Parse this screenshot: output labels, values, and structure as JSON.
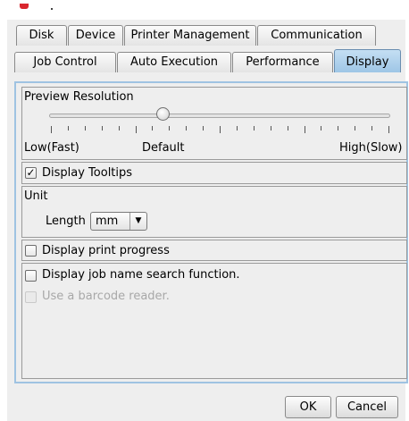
{
  "tabs_row1": [
    {
      "label": "Disk"
    },
    {
      "label": "Device"
    },
    {
      "label": "Printer Management"
    },
    {
      "label": "Communication"
    }
  ],
  "tabs_row2": [
    {
      "label": "Job Control"
    },
    {
      "label": "Auto Execution"
    },
    {
      "label": "Performance"
    },
    {
      "label": "Display",
      "selected": true
    }
  ],
  "preview": {
    "title": "Preview Resolution",
    "low_label": "Low(Fast)",
    "default_label": "Default",
    "high_label": "High(Slow)",
    "level": 0.33
  },
  "tooltips": {
    "label": "Display Tooltips",
    "checked": true,
    "check_glyph": "✓"
  },
  "unit": {
    "title": "Unit",
    "length_label": "Length",
    "length_value": "mm",
    "arrow_glyph": "▼"
  },
  "print_progress": {
    "label": "Display print progress",
    "checked": false
  },
  "job_search": {
    "label": "Display job name search function.",
    "checked": false
  },
  "barcode": {
    "label": "Use a barcode reader.",
    "checked": false,
    "enabled": false
  },
  "buttons": {
    "ok": "OK",
    "cancel": "Cancel"
  },
  "colors": {
    "selected_tab": "#a9cdec",
    "panel_border": "#9fc3e2",
    "app_icon": "#d9262e"
  }
}
